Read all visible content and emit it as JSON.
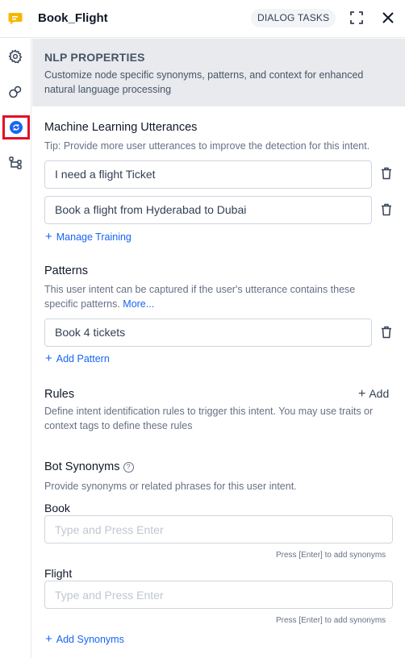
{
  "header": {
    "app_icon": "chat-bubble-icon",
    "title": "Book_Flight",
    "badge": "DIALOG TASKS",
    "expand_icon": "expand-icon",
    "close_icon": "close-icon"
  },
  "sidebar": {
    "items": [
      {
        "name": "settings",
        "icon": "gear-icon"
      },
      {
        "name": "connections",
        "icon": "link-icon"
      },
      {
        "name": "nlp",
        "icon": "nlp-icon",
        "active": true
      },
      {
        "name": "flow",
        "icon": "branch-icon"
      }
    ]
  },
  "banner": {
    "title": "NLP PROPERTIES",
    "description": "Customize node specific synonyms, patterns, and context for enhanced natural language processing"
  },
  "utterances": {
    "title": "Machine Learning Utterances",
    "tip": "Tip: Provide more user utterances to improve the detection for this intent.",
    "items": [
      "I need a flight Ticket",
      "Book a flight from Hyderabad to Dubai"
    ],
    "manage_label": "Manage Training"
  },
  "patterns": {
    "title": "Patterns",
    "description": "This user intent can be captured if the user's utterance contains these specific patterns.",
    "more_label": "More...",
    "items": [
      "Book 4 tickets"
    ],
    "add_label": "Add Pattern"
  },
  "rules": {
    "title": "Rules",
    "add_label": "Add",
    "description": "Define intent identification rules to trigger this intent. You may use traits or context tags to define these rules"
  },
  "synonyms": {
    "title": "Bot Synonyms",
    "help_glyph": "?",
    "description": "Provide synonyms or related phrases for this user intent.",
    "fields": [
      {
        "label": "Book",
        "placeholder": "Type and Press Enter",
        "hint": "Press [Enter] to add synonyms"
      },
      {
        "label": "Flight",
        "placeholder": "Type and Press Enter",
        "hint": "Press [Enter] to add synonyms"
      }
    ],
    "add_label": "Add Synonyms"
  },
  "colors": {
    "accent": "#1765f5",
    "active_outline": "#e0102a",
    "app_icon": "#f5b800",
    "banner_bg": "#e8eaed"
  }
}
